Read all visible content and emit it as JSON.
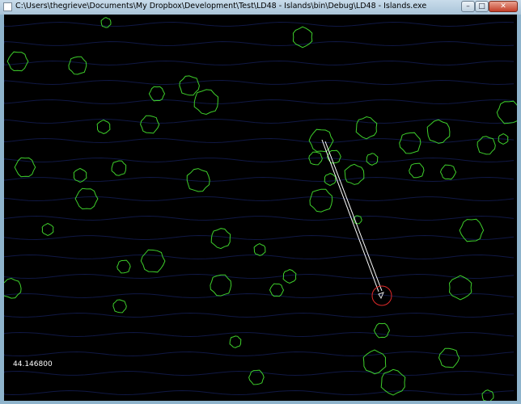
{
  "window": {
    "title": "C:\\Users\\thegrieve\\Documents\\My Dropbox\\Development\\Test\\LD48 - Islands\\bin\\Debug\\LD48 - Islands.exe",
    "controls": {
      "minimize": "–",
      "maximize": "□",
      "close": "✕"
    }
  },
  "hud": {
    "fps_value": "44.146800"
  },
  "colors": {
    "island": "#3ecf2b",
    "water": "#101845",
    "player": "#e02a2a",
    "aim_line": "#ffffff",
    "target": "#dddddd",
    "text": "#ffffff",
    "background": "#000000"
  }
}
